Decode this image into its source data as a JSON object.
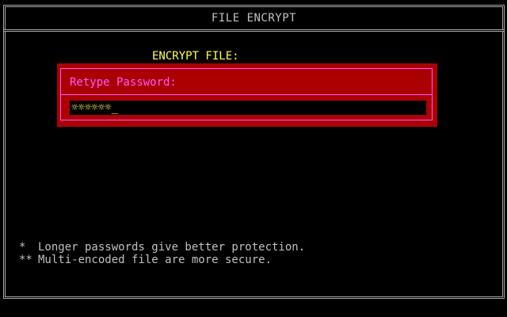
{
  "app": {
    "title": "FILE ENCRYPT"
  },
  "dialog": {
    "heading": "ENCRYPT FILE:",
    "prompt": "Retype Password:",
    "password_mask": "☼☼☼☼☼☼",
    "cursor": "_"
  },
  "hints": [
    {
      "bullet": "*",
      "text": "Longer passwords give better protection."
    },
    {
      "bullet": "**",
      "text": "Multi-encoded file are more secure."
    }
  ],
  "colors": {
    "background": "#000000",
    "dialog_bg": "#aa0000",
    "dialog_border": "#ff55ff",
    "heading": "#ffff55",
    "input_text": "#ffff55",
    "frame": "#a8a8a8",
    "text": "#c0c0c0"
  }
}
